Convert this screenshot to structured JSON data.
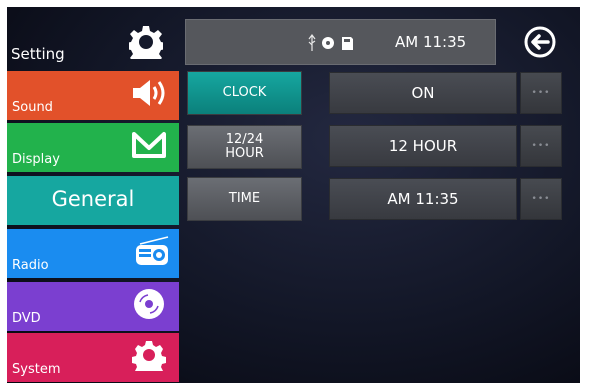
{
  "sidebar": {
    "header": {
      "title": "Setting",
      "icon": "gear-icon"
    },
    "items": [
      {
        "label": "Sound",
        "icon": "speaker-icon",
        "color": "#e2512a"
      },
      {
        "label": "Display",
        "icon": "display-icon",
        "color": "#22b24c"
      },
      {
        "label": "General",
        "icon": "",
        "color": "#16a7a0",
        "selected": true
      },
      {
        "label": "Radio",
        "icon": "radio-icon",
        "color": "#1a8cf0"
      },
      {
        "label": "DVD",
        "icon": "disc-icon",
        "color": "#7b3fd0"
      },
      {
        "label": "System",
        "icon": "system-gear-icon",
        "color": "#d81f5a"
      }
    ]
  },
  "status_bar": {
    "icons": [
      "usb-icon",
      "disc-status-icon",
      "sd-card-icon"
    ],
    "time": "AM 11:35"
  },
  "back_button": {
    "icon": "back-arrow-icon"
  },
  "settings": [
    {
      "label": "CLOCK",
      "value": "ON",
      "active": true,
      "more_icon": "more-icon"
    },
    {
      "label": "12/24\nHOUR",
      "value": "12 HOUR",
      "active": false,
      "more_icon": "more-icon"
    },
    {
      "label": "TIME",
      "value": "AM 11:35",
      "active": false,
      "more_icon": "more-icon"
    }
  ],
  "colors": {
    "accent_teal": "#16a7a0",
    "background": "#121626"
  }
}
